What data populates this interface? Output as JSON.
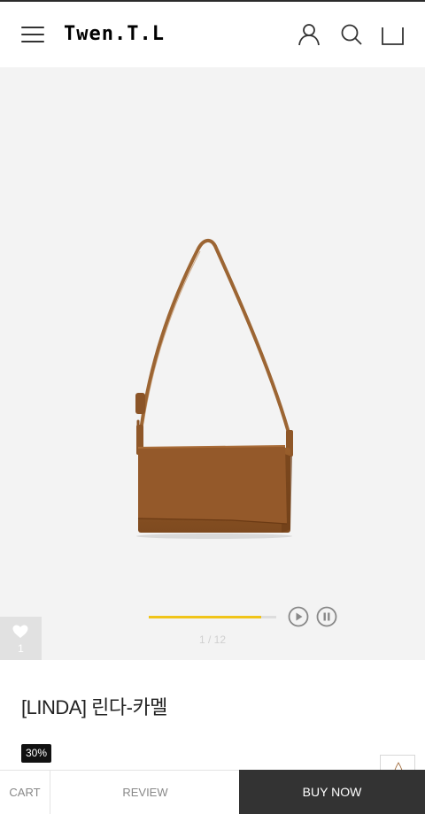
{
  "header": {
    "logo": "Twen.T.L",
    "icons": [
      "menu-icon",
      "user-icon",
      "search-icon",
      "shopping-bag-icon"
    ]
  },
  "gallery": {
    "image": "brown-leather-shoulder-bag",
    "background_color": "#f3f3f3",
    "slide_progress": 0.88,
    "progress_color": "#f0c419",
    "counter": "1 / 12",
    "like_count": "1"
  },
  "product": {
    "title": "[LINDA] 린다-카멜",
    "discount_badge": "30%"
  },
  "bottom_bar": {
    "cart_label": "CART",
    "review_label": "REVIEW",
    "buy_label": "BUY NOW"
  }
}
